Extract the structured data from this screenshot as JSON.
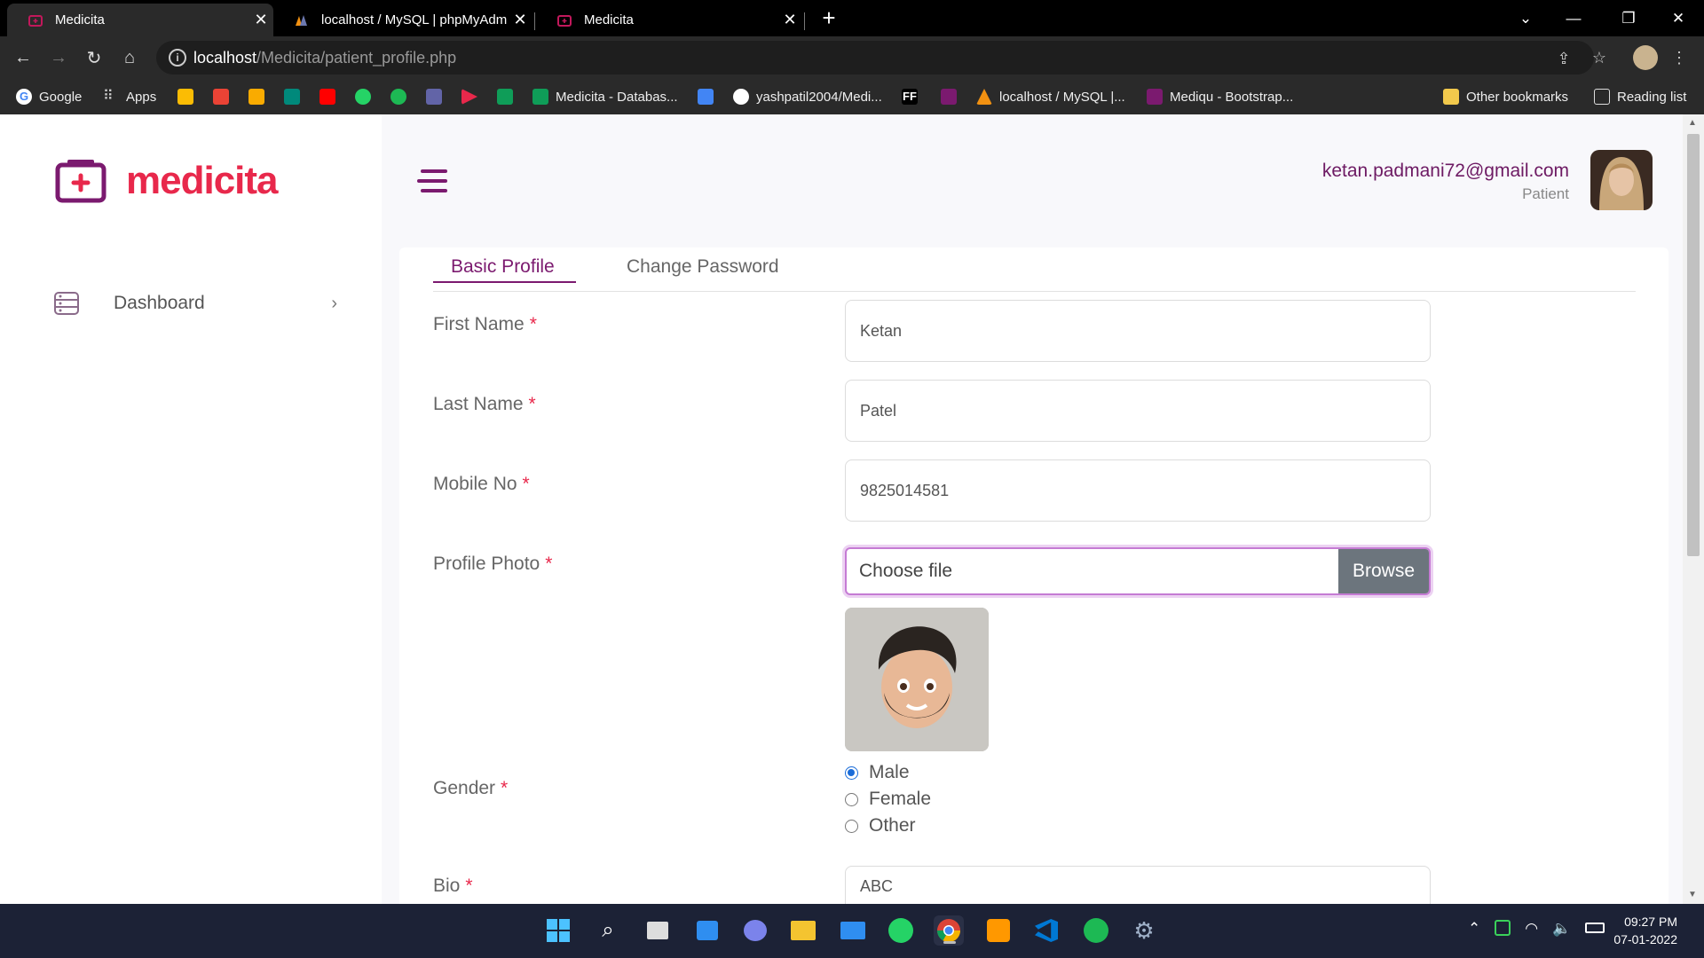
{
  "browser": {
    "tabs": [
      {
        "title": "Medicita",
        "active": true
      },
      {
        "title": "localhost / MySQL | phpMyAdmin",
        "active": false
      },
      {
        "title": "Medicita",
        "active": false
      }
    ],
    "new_tab_label": "+",
    "url_host": "localhost",
    "url_path": "/Medicita/patient_profile.php",
    "bookmarks": [
      {
        "label": "Google",
        "color": "#4285f4"
      },
      {
        "label": "Apps",
        "color": "#cccccc"
      },
      {
        "label": "Medicita - Databas...",
        "color": "#0f9d58"
      },
      {
        "label": "yashpatil2004/Medi...",
        "color": "#ffffff"
      },
      {
        "label": "FF",
        "color": "#000000"
      },
      {
        "label": "localhost / MySQL |...",
        "color": "#f29111"
      },
      {
        "label": "Mediqu - Bootstrap...",
        "color": "#e8284b"
      }
    ],
    "other_bookmarks": "Other bookmarks",
    "reading_list": "Reading list"
  },
  "sidebar": {
    "logo_text": "medicita",
    "items": [
      {
        "label": "Dashboard",
        "icon": "dashboard-icon"
      }
    ]
  },
  "header": {
    "user_email": "ketan.padmani72@gmail.com",
    "user_role": "Patient"
  },
  "profile": {
    "tabs": [
      {
        "label": "Basic Profile",
        "active": true
      },
      {
        "label": "Change Password",
        "active": false
      }
    ],
    "fields": {
      "first_name": {
        "label": "First Name",
        "value": "Ketan"
      },
      "last_name": {
        "label": "Last Name",
        "value": "Patel"
      },
      "mobile": {
        "label": "Mobile No",
        "value": "9825014581"
      },
      "photo": {
        "label": "Profile Photo",
        "file_placeholder": "Choose file",
        "browse": "Browse"
      },
      "gender": {
        "label": "Gender",
        "options": [
          "Male",
          "Female",
          "Other"
        ],
        "selected": "Male"
      },
      "bio": {
        "label": "Bio",
        "value": "ABC"
      }
    },
    "required_mark": "*"
  },
  "taskbar": {
    "time": "09:27 PM",
    "date": "07-01-2022"
  },
  "colors": {
    "brand": "#7b1a6f",
    "logo": "#e8284b",
    "radio_selected": "#1a6cd8"
  }
}
